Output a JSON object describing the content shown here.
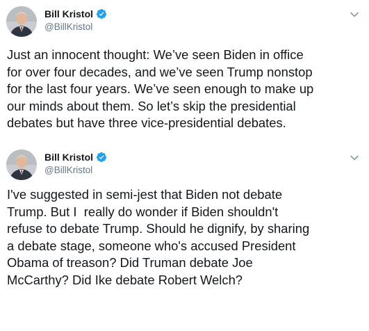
{
  "tweets": [
    {
      "author": {
        "display_name": "Bill Kristol",
        "handle": "@BillKristol",
        "verified": true
      },
      "text": "Just an innocent thought: We’ve seen Biden in office\nfor over four decades, and we’ve seen Trump nonstop\nfor the last four years. We’ve seen enough to make up\nour minds about them. So let’s skip the presidential\ndebates but have three vice-presidential debates."
    },
    {
      "author": {
        "display_name": "Bill Kristol",
        "handle": "@BillKristol",
        "verified": true
      },
      "text": "I've suggested in semi-jest that Biden not debate\nTrump. But I  really do wonder if Biden shouldn't\nrefuse to debate Trump. Should he dignify, by sharing\na debate stage, someone who's accused President\nObama of treason? Did Truman debate Joe\nMcCarthy? Did Ike debate Robert Welch?"
    }
  ],
  "colors": {
    "verified_blue": "#1da1f2",
    "text_primary": "#14171a",
    "text_secondary": "#657786",
    "chevron": "#8899a6"
  },
  "icons": {
    "verified": "verified-badge-icon",
    "menu": "chevron-down-icon"
  }
}
